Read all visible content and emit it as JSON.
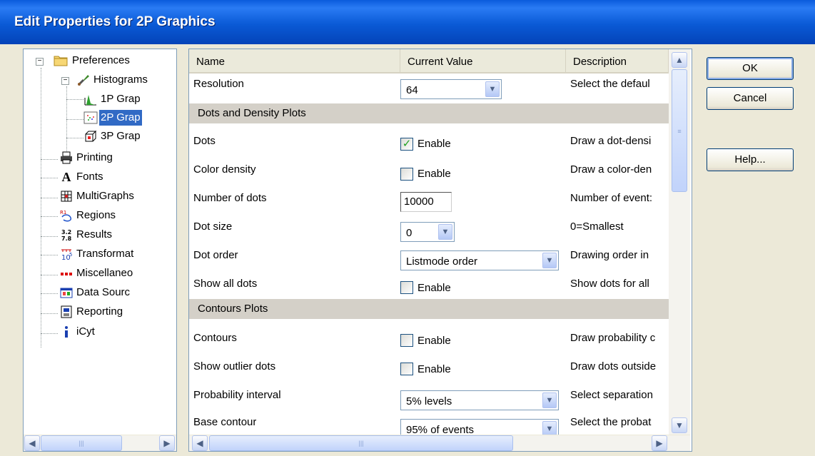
{
  "window": {
    "title": "Edit Properties for 2P Graphics"
  },
  "tree": {
    "items": [
      {
        "label": "Preferences",
        "icon": "folder-icon"
      },
      {
        "label": "Histograms",
        "icon": "brush-icon"
      },
      {
        "label": "1P Grap",
        "icon": "histogram-icon"
      },
      {
        "label": "2P Grap",
        "icon": "scatter-icon"
      },
      {
        "label": "3P Grap",
        "icon": "cube-icon"
      },
      {
        "label": "Printing",
        "icon": "printer-icon"
      },
      {
        "label": "Fonts",
        "icon": "font-icon"
      },
      {
        "label": "MultiGraphs",
        "icon": "grid-icon"
      },
      {
        "label": "Regions",
        "icon": "regions-icon"
      },
      {
        "label": "Results",
        "icon": "results-icon"
      },
      {
        "label": "Transformat",
        "icon": "transform-icon"
      },
      {
        "label": "Miscellaneo",
        "icon": "dots-icon"
      },
      {
        "label": "Data Sourc",
        "icon": "data-source-icon"
      },
      {
        "label": "Reporting",
        "icon": "report-icon"
      },
      {
        "label": "iCyt",
        "icon": "info-icon"
      }
    ]
  },
  "grid": {
    "columns": [
      "Name",
      "Current Value",
      "Description"
    ],
    "rows": [
      {
        "name": "Resolution",
        "type": "combo",
        "value": "64",
        "desc": "Select the defaul"
      },
      {
        "section": "Dots and Density Plots"
      },
      {
        "name": "Dots",
        "type": "check",
        "checked": true,
        "value": "Enable",
        "desc": "Draw a dot-densi"
      },
      {
        "name": "Color density",
        "type": "check",
        "checked": false,
        "value": "Enable",
        "desc": "Draw a color-den"
      },
      {
        "name": "Number of dots",
        "type": "text",
        "value": "10000",
        "desc": "Number of event:"
      },
      {
        "name": "Dot size",
        "type": "combo",
        "value": "0",
        "desc": "0=Smallest"
      },
      {
        "name": "Dot order",
        "type": "combo",
        "value": "Listmode order",
        "desc": "Drawing order in"
      },
      {
        "name": "Show all dots",
        "type": "check",
        "checked": false,
        "value": "Enable",
        "desc": "Show dots for all"
      },
      {
        "section": "Contours Plots"
      },
      {
        "name": "Contours",
        "type": "check",
        "checked": false,
        "value": "Enable",
        "desc": "Draw probability c"
      },
      {
        "name": "Show outlier dots",
        "type": "check",
        "checked": false,
        "value": "Enable",
        "desc": "Draw dots outside"
      },
      {
        "name": "Probability interval",
        "type": "combo",
        "value": "5% levels",
        "desc": "Select separation"
      },
      {
        "name": "Base contour",
        "type": "combo",
        "value": "95% of events",
        "desc": "Select the probat"
      }
    ]
  },
  "buttons": {
    "ok": "OK",
    "cancel": "Cancel",
    "help": "Help..."
  },
  "colors": {
    "titlebar": "#0a5ad6",
    "selection": "#316ac5",
    "section": "#d4d0c8",
    "check": "#21a121"
  }
}
